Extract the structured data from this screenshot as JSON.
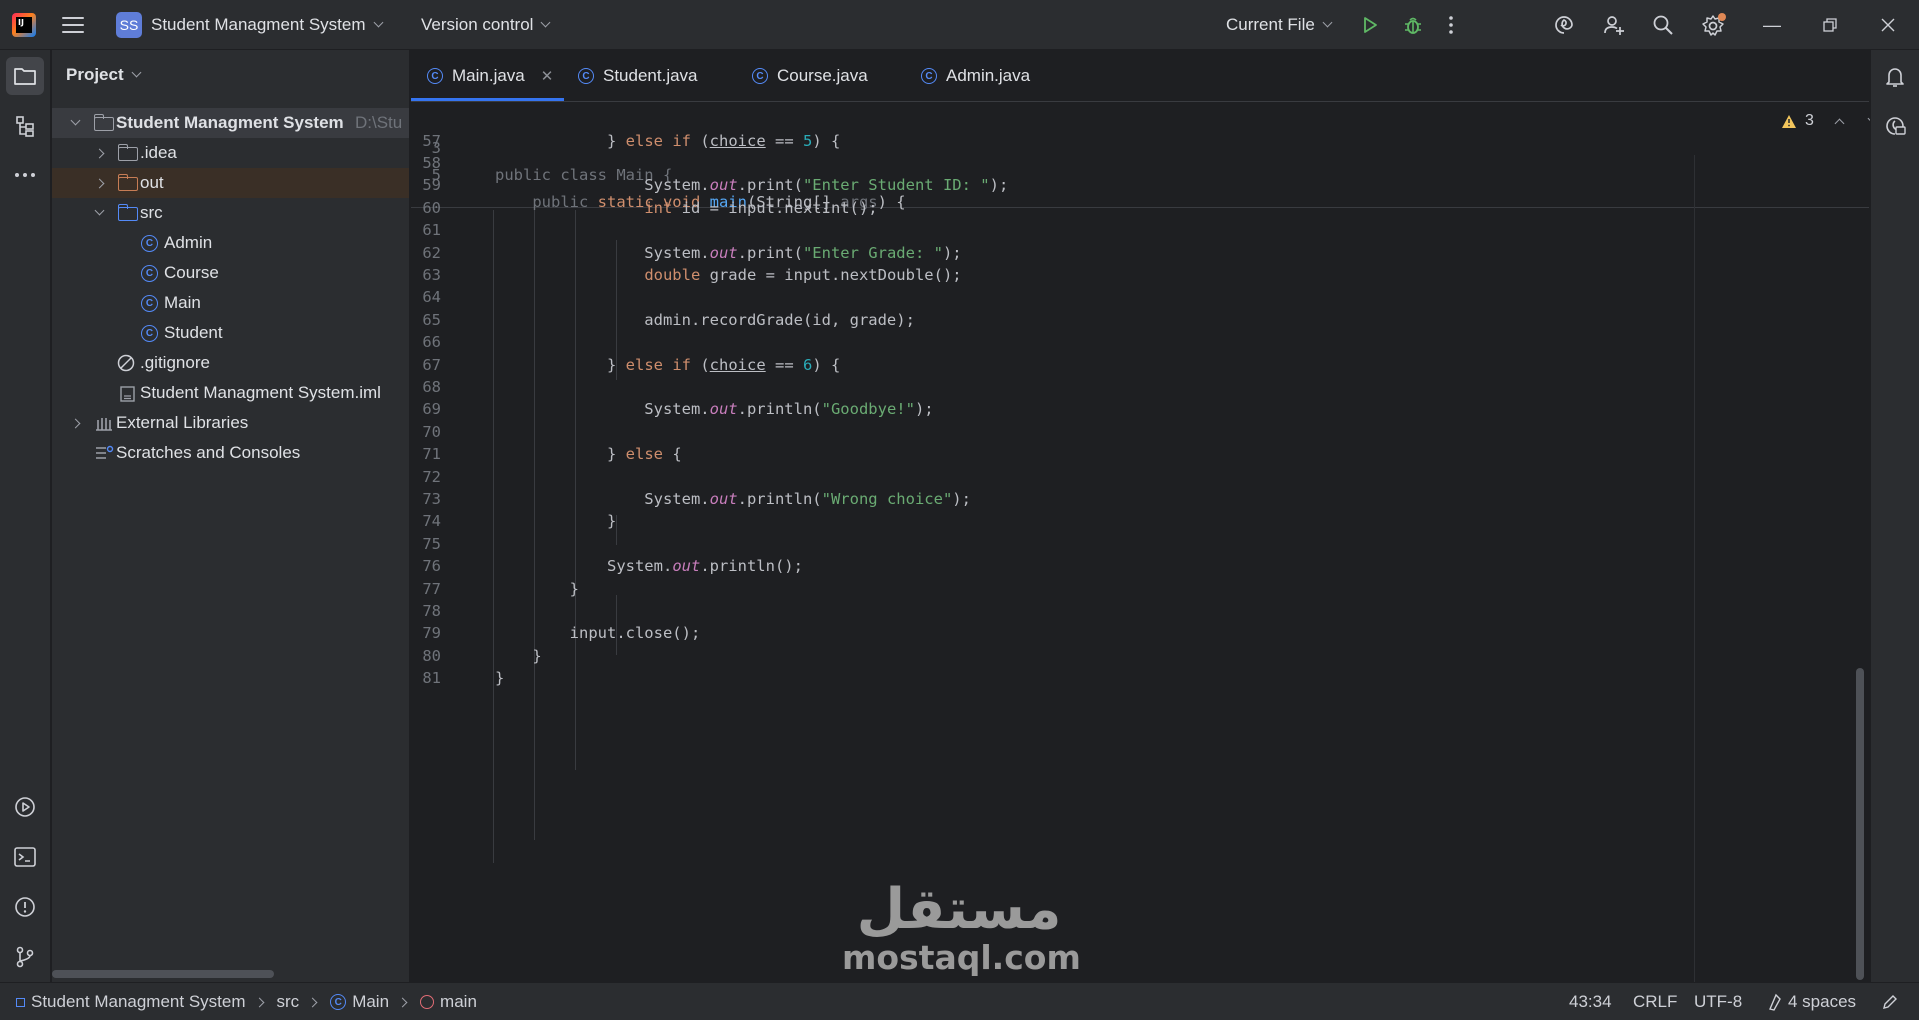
{
  "titlebar": {
    "project_badge": "SS",
    "project_name": "Student Managment System",
    "vcs": "Version control",
    "run_config": "Current File"
  },
  "project_panel": {
    "title": "Project",
    "tree": [
      {
        "label": "Student Managment System",
        "suffix": "D:\\Stu"
      },
      {
        "label": ".idea"
      },
      {
        "label": "out"
      },
      {
        "label": "src"
      },
      {
        "label": "Admin"
      },
      {
        "label": "Course"
      },
      {
        "label": "Main"
      },
      {
        "label": "Student"
      },
      {
        "label": ".gitignore"
      },
      {
        "label": "Student Managment System.iml"
      },
      {
        "label": "External Libraries"
      },
      {
        "label": "Scratches and Consoles"
      }
    ]
  },
  "tabs": [
    {
      "label": "Main.java"
    },
    {
      "label": "Student.java"
    },
    {
      "label": "Course.java"
    },
    {
      "label": "Admin.java"
    }
  ],
  "editor": {
    "warnings_count": "3",
    "sticky_lines": [
      {
        "n": "3",
        "code": "public class Main {"
      },
      {
        "n": "5",
        "code": "    public static void main(String[] args) {"
      }
    ],
    "lines": [
      {
        "n": "57",
        "code": "            } else if (choice == 5) {"
      },
      {
        "n": "58",
        "code": ""
      },
      {
        "n": "59",
        "code": "                System.out.print(\"Enter Student ID: \");"
      },
      {
        "n": "60",
        "code": "                int id = input.nextInt();"
      },
      {
        "n": "61",
        "code": ""
      },
      {
        "n": "62",
        "code": "                System.out.print(\"Enter Grade: \");"
      },
      {
        "n": "63",
        "code": "                double grade = input.nextDouble();"
      },
      {
        "n": "64",
        "code": ""
      },
      {
        "n": "65",
        "code": "                admin.recordGrade(id, grade);"
      },
      {
        "n": "66",
        "code": ""
      },
      {
        "n": "67",
        "code": "            } else if (choice == 6) {"
      },
      {
        "n": "68",
        "code": ""
      },
      {
        "n": "69",
        "code": "                System.out.println(\"Goodbye!\");"
      },
      {
        "n": "70",
        "code": ""
      },
      {
        "n": "71",
        "code": "            } else {"
      },
      {
        "n": "72",
        "code": ""
      },
      {
        "n": "73",
        "code": "                System.out.println(\"Wrong choice\");"
      },
      {
        "n": "74",
        "code": "            }"
      },
      {
        "n": "75",
        "code": ""
      },
      {
        "n": "76",
        "code": "            System.out.println();"
      },
      {
        "n": "77",
        "code": "        }"
      },
      {
        "n": "78",
        "code": ""
      },
      {
        "n": "79",
        "code": "        input.close();"
      },
      {
        "n": "80",
        "code": "    }"
      },
      {
        "n": "81",
        "code": "}"
      }
    ]
  },
  "statusbar": {
    "breadcrumb": [
      "Student Managment System",
      "src",
      "Main",
      "main"
    ],
    "position": "43:34",
    "line_sep": "CRLF",
    "encoding": "UTF-8",
    "indent": "4 spaces"
  },
  "watermark": {
    "arabic": "مستقل",
    "latin": "mostaql.com"
  },
  "colors": {
    "accent": "#3574f0",
    "keyword": "#cf8e6d",
    "string": "#6aab73",
    "number": "#2aacb8",
    "field": "#c77dbb",
    "method": "#56a8f5"
  }
}
